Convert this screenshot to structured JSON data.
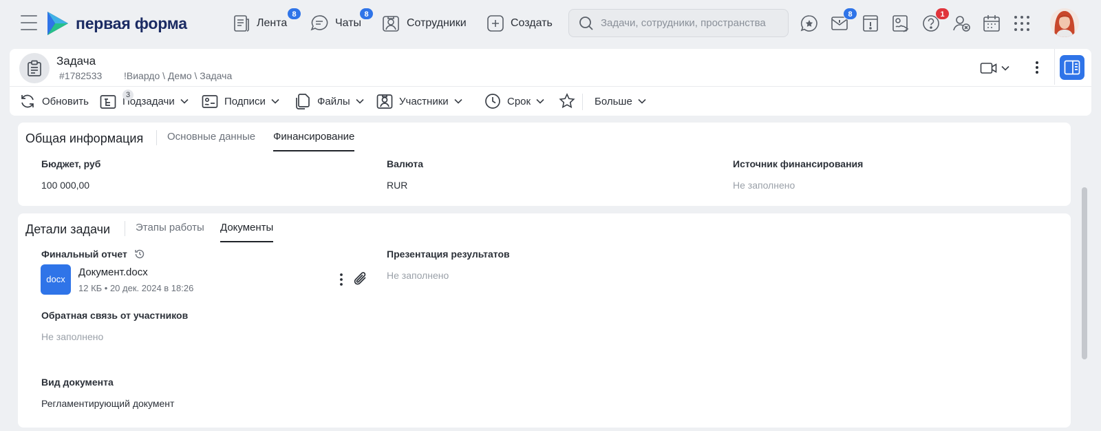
{
  "brand": {
    "name": "первая форма"
  },
  "nav": [
    {
      "label": "Лента",
      "badge": "8",
      "icon": "feed-icon"
    },
    {
      "label": "Чаты",
      "badge": "8",
      "icon": "chat-icon"
    },
    {
      "label": "Сотрудники",
      "badge": "",
      "icon": "employees-icon"
    },
    {
      "label": "Создать",
      "badge": "",
      "icon": "plus-square-icon"
    }
  ],
  "search": {
    "placeholder": "Задачи, сотрудники, пространства",
    "value": ""
  },
  "top_icons": {
    "inbox_badge": "8",
    "help_badge": "1"
  },
  "task": {
    "type": "Задача",
    "number": "#1782533",
    "path": "!Виардо \\ Демо \\ Задача"
  },
  "toolbar": {
    "refresh": "Обновить",
    "subtasks": "Подзадачи",
    "subtasks_count": "3",
    "signatures": "Подписи",
    "files": "Файлы",
    "participants": "Участники",
    "deadline": "Срок",
    "more": "Больше"
  },
  "general": {
    "title": "Общая информация",
    "tabs": [
      "Основные данные",
      "Финансирование"
    ],
    "active_tab": "Финансирование",
    "fields": {
      "budget_label": "Бюджет, руб",
      "budget_value": "100 000,00",
      "currency_label": "Валюта",
      "currency_value": "RUR",
      "source_label": "Источник финансирования",
      "source_value": "Не заполнено"
    }
  },
  "details": {
    "title": "Детали задачи",
    "tabs": [
      "Этапы работы",
      "Документы"
    ],
    "active_tab": "Документы",
    "final_report_label": "Финальный отчет",
    "document": {
      "ext": "docx",
      "name": "Документ.docx",
      "meta": "12 КБ • 20 дек. 2024 в 18:26"
    },
    "presentation_label": "Презентация результатов",
    "presentation_value": "Не заполнено",
    "feedback_label": "Обратная связь от участников",
    "feedback_value": "Не заполнено",
    "doc_type_label": "Вид документа",
    "doc_type_value": "Регламентирующий документ"
  },
  "colors": {
    "accent": "#2f74e8",
    "badge_red": "#e0343b",
    "brand_navy": "#1b2b63",
    "background": "#eef0f3"
  }
}
